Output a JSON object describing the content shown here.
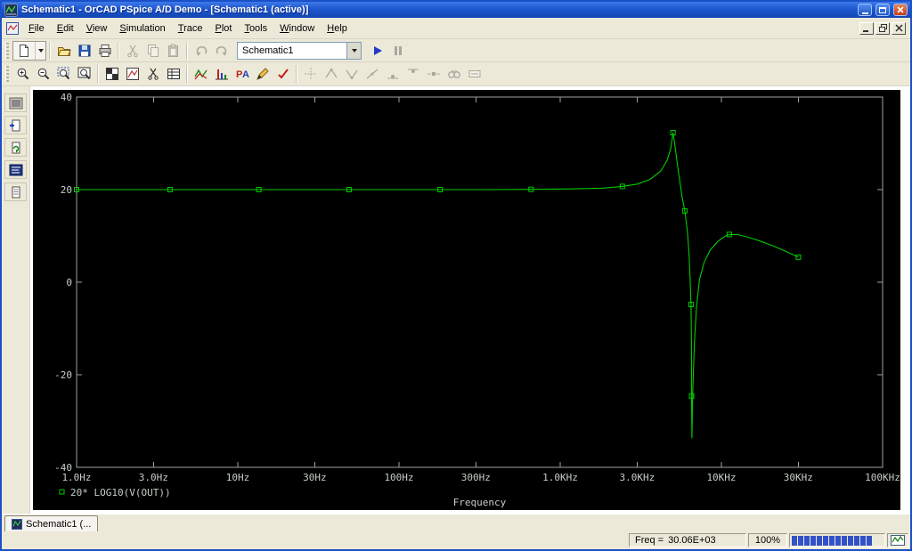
{
  "window": {
    "title": "Schematic1 - OrCAD PSpice A/D Demo - [Schematic1 (active)]"
  },
  "menu": {
    "items": [
      "File",
      "Edit",
      "View",
      "Simulation",
      "Trace",
      "Plot",
      "Tools",
      "Window",
      "Help"
    ]
  },
  "toolbar_main": {
    "profile_value": "Schematic1",
    "buttons": [
      "new-simulation",
      "open",
      "save",
      "print",
      "cut",
      "copy",
      "paste",
      "undo",
      "redo",
      "simulation-profile-combobox",
      "run",
      "pause"
    ]
  },
  "toolbar_chart": {
    "buttons": [
      "zoom-in",
      "zoom-out",
      "zoom-area",
      "zoom-fit",
      "plot-grid",
      "axis-settings",
      "cut-plot",
      "data-table",
      "add-trace",
      "fourier",
      "performance-analysis",
      "goal-function",
      "evaluate-measurement",
      "toggle-cursor",
      "cursor-peak",
      "cursor-trough",
      "cursor-slope",
      "cursor-min",
      "cursor-max",
      "cursor-point",
      "cursor-search",
      "mark-label"
    ]
  },
  "sidebar": {
    "buttons": [
      "view-simulation-results",
      "view-schematic-page",
      "view-simulation-queue",
      "view-output-window",
      "view-output-file"
    ]
  },
  "tabs": [
    {
      "label": "Schematic1 (..."
    }
  ],
  "statusbar": {
    "freq_label": "Freq =",
    "freq_value": "30.06E+03",
    "zoom": "100%",
    "progress_segments": 13,
    "progress_color": "#3152c8"
  },
  "colors": {
    "titlebar_blue": "#1e57d0",
    "trace_green": "#00cc00",
    "plot_background": "#000000"
  },
  "chart_data": {
    "type": "line",
    "title": "",
    "xlabel": "Frequency",
    "ylabel": "",
    "x_scale": "log",
    "x_range_hz": [
      1,
      100000
    ],
    "y_range_db": [
      -40,
      40
    ],
    "grid": false,
    "background": "#000000",
    "axis_color": "#9aa49a",
    "text_color": "#c6cec6",
    "x_ticks": [
      {
        "value": 1,
        "label": "1.0Hz"
      },
      {
        "value": 3,
        "label": "3.0Hz"
      },
      {
        "value": 10,
        "label": "10Hz"
      },
      {
        "value": 30,
        "label": "30Hz"
      },
      {
        "value": 100,
        "label": "100Hz"
      },
      {
        "value": 300,
        "label": "300Hz"
      },
      {
        "value": 1000,
        "label": "1.0KHz"
      },
      {
        "value": 3000,
        "label": "3.0KHz"
      },
      {
        "value": 10000,
        "label": "10KHz"
      },
      {
        "value": 30000,
        "label": "30KHz"
      },
      {
        "value": 100000,
        "label": "100KHz"
      }
    ],
    "y_ticks": [
      {
        "value": 40,
        "label": "40"
      },
      {
        "value": 20,
        "label": "20"
      },
      {
        "value": 0,
        "label": "0"
      },
      {
        "value": -20,
        "label": "-20"
      },
      {
        "value": -40,
        "label": "-40"
      }
    ],
    "series": [
      {
        "name": "20*LOG10(V(OUT))",
        "legend_label": "20* LOG10(V(OUT))",
        "color": "#00cc00",
        "points": [
          [
            1,
            20
          ],
          [
            2,
            20
          ],
          [
            3.8,
            20
          ],
          [
            7,
            20
          ],
          [
            13.5,
            20
          ],
          [
            25,
            20
          ],
          [
            49,
            20
          ],
          [
            90,
            20
          ],
          [
            180,
            20
          ],
          [
            350,
            20
          ],
          [
            660,
            20.05
          ],
          [
            1200,
            20.15
          ],
          [
            1800,
            20.3
          ],
          [
            2430,
            20.7
          ],
          [
            3000,
            21.2
          ],
          [
            3600,
            22.2
          ],
          [
            4200,
            24
          ],
          [
            4600,
            26.3
          ],
          [
            4850,
            28.8
          ],
          [
            5012,
            32.3
          ],
          [
            5150,
            29.5
          ],
          [
            5400,
            24
          ],
          [
            5700,
            18.5
          ],
          [
            5930,
            15.4
          ],
          [
            6150,
            11
          ],
          [
            6300,
            6
          ],
          [
            6400,
            0.5
          ],
          [
            6480,
            -4.8
          ],
          [
            6520,
            -13
          ],
          [
            6530,
            -24.6
          ],
          [
            6560,
            -33.7
          ],
          [
            6640,
            -24
          ],
          [
            6800,
            -13
          ],
          [
            7000,
            -5.5
          ],
          [
            7300,
            0.5
          ],
          [
            7800,
            4.2
          ],
          [
            8500,
            6.9
          ],
          [
            9500,
            8.8
          ],
          [
            10500,
            9.9
          ],
          [
            11200,
            10.3
          ],
          [
            12500,
            10.3
          ],
          [
            14000,
            9.9
          ],
          [
            16000,
            9.3
          ],
          [
            18000,
            8.7
          ],
          [
            21000,
            7.8
          ],
          [
            25000,
            6.7
          ],
          [
            30000,
            5.4
          ]
        ],
        "marker_points": [
          [
            1,
            20
          ],
          [
            3.8,
            20
          ],
          [
            13.5,
            20
          ],
          [
            49,
            20
          ],
          [
            180,
            20
          ],
          [
            660,
            20.05
          ],
          [
            2430,
            20.7
          ],
          [
            5012,
            32.3
          ],
          [
            5930,
            15.4
          ],
          [
            6480,
            -4.8
          ],
          [
            6530,
            -24.6
          ],
          [
            11200,
            10.3
          ],
          [
            30000,
            5.4
          ]
        ]
      }
    ],
    "legend_position": "bottom-left"
  }
}
